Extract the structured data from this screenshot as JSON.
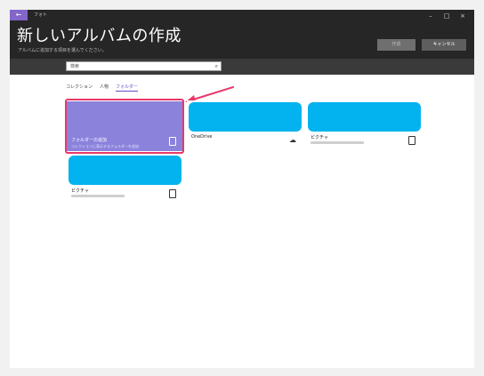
{
  "window": {
    "app_name": "フォト",
    "back_icon": "arrow-left-icon",
    "controls": {
      "minimize": "–",
      "maximize": "□",
      "close": "×"
    }
  },
  "header": {
    "title": "新しいアルバムの作成",
    "subtitle": "アルバムに追加する項目を選んでください。",
    "create_label": "作成",
    "cancel_label": "キャンセル"
  },
  "search": {
    "value": "検索",
    "icon": "search-icon"
  },
  "tabs": [
    {
      "label": "コレクション",
      "active": false
    },
    {
      "label": "人物",
      "active": false
    },
    {
      "label": "フォルダー",
      "active": true
    }
  ],
  "tiles": [
    {
      "name": "フォルダーの追加",
      "subtitle": "コレクションに表示するフォルダーを追加",
      "icon": "tablet-icon",
      "highlighted": true
    },
    {
      "name": "OneDrive",
      "icon": "cloud-icon"
    },
    {
      "name": "ピクチャ",
      "icon": "tablet-icon"
    },
    {
      "name": "ピクチャ",
      "icon": "tablet-icon"
    }
  ],
  "colors": {
    "accent": "#8266c9",
    "tile_thumb": "#03b3ef",
    "folder_tile": "#8b82dc",
    "highlight": "#e8386a"
  }
}
